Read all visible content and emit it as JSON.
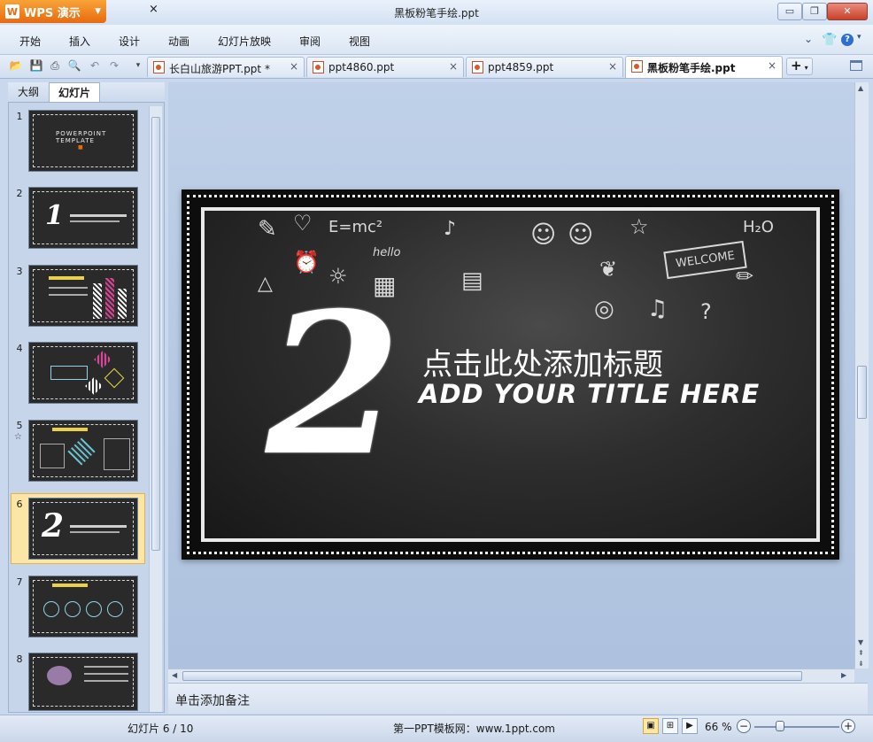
{
  "app": {
    "name": "WPS 演示",
    "document_title": "黑板粉笔手绘.ppt"
  },
  "window_controls": {
    "minimize": "▭",
    "restore": "❐",
    "close": "✕"
  },
  "menu": {
    "items": [
      "开始",
      "插入",
      "设计",
      "动画",
      "幻灯片放映",
      "审阅",
      "视图"
    ],
    "right_dropdown": "⌄",
    "help": "?"
  },
  "toolbar_icons": [
    "open-folder-icon",
    "save-icon",
    "print-icon",
    "print-preview-icon",
    "undo-icon",
    "redo-icon",
    "customize-icon"
  ],
  "tabs": [
    {
      "label": "长白山旅游PPT.ppt *",
      "active": false
    },
    {
      "label": "ppt4860.ppt",
      "active": false
    },
    {
      "label": "ppt4859.ppt",
      "active": false
    },
    {
      "label": "黑板粉笔手绘.ppt",
      "active": true
    }
  ],
  "tab_close": "×",
  "new_tab": "+",
  "left_pane": {
    "tab_outline": "大纲",
    "tab_slides": "幻灯片",
    "close": "×",
    "slides": [
      {
        "num": "1",
        "caption": "POWERPOINT TEMPLATE"
      },
      {
        "num": "2",
        "caption": "1"
      },
      {
        "num": "3",
        "caption": ""
      },
      {
        "num": "4",
        "caption": ""
      },
      {
        "num": "5",
        "caption": ""
      },
      {
        "num": "6",
        "caption": "2"
      },
      {
        "num": "7",
        "caption": ""
      },
      {
        "num": "8",
        "caption": ""
      }
    ],
    "selected_slide": 6
  },
  "slide": {
    "number_glyph": "2",
    "title_cn": "点击此处添加标题",
    "title_en": "ADD YOUR TITLE HERE",
    "doodles": [
      "E=mc²",
      "hello",
      "WELCOME",
      "H₂O"
    ]
  },
  "notes": {
    "placeholder": "单击添加备注"
  },
  "status": {
    "slide_info": "幻灯片 6 / 10",
    "site": "第一PPT模板网：www.1ppt.com",
    "zoom": "66 %",
    "zoom_level": 0.3
  }
}
